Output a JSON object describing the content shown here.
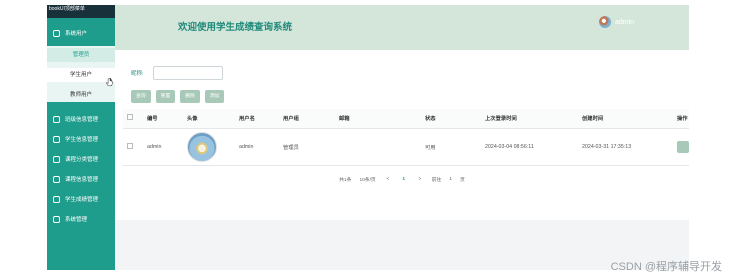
{
  "sidebar": {
    "brand": "bookUI顶部菜单",
    "section_label": "系统用户",
    "sub_items": [
      {
        "label": "管理员"
      },
      {
        "label": "学生用户"
      },
      {
        "label": "教师用户"
      }
    ],
    "menu_items": [
      {
        "label": "班级信息管理"
      },
      {
        "label": "学生信息管理"
      },
      {
        "label": "课程分类管理"
      },
      {
        "label": "课程信息管理"
      },
      {
        "label": "学生成绩管理"
      },
      {
        "label": "系统管理"
      }
    ]
  },
  "header": {
    "title": "欢迎使用学生成绩查询系统",
    "user": "admin"
  },
  "search": {
    "label": "昵称:",
    "value": ""
  },
  "toolbar": {
    "buttons": [
      {
        "label": "查询"
      },
      {
        "label": "重置"
      },
      {
        "label": "删除"
      },
      {
        "label": "添加"
      }
    ]
  },
  "table": {
    "headers": [
      "",
      "编号",
      "头像",
      "用户名",
      "用户组",
      "邮箱",
      "状态",
      "上次登录时间",
      "创建时间",
      "操作"
    ],
    "rows": [
      {
        "id": "admin",
        "username": "admin",
        "group": "管理员",
        "email": "",
        "status": "可用",
        "last_login": "2024-03-04 08:56:11",
        "created": "2024-03-31 17:35:13"
      }
    ]
  },
  "pager": {
    "total": "共1条",
    "per_page": "10条/页",
    "prev": "<",
    "current": "1",
    "next": ">",
    "goto_label": "前往",
    "goto_value": "1",
    "page_unit": "页"
  },
  "watermark": "CSDN @程序辅导开发",
  "colors": {
    "sidebar": "#1f9d8c",
    "header": "#d4e6da",
    "accent": "#1f8a7a"
  }
}
